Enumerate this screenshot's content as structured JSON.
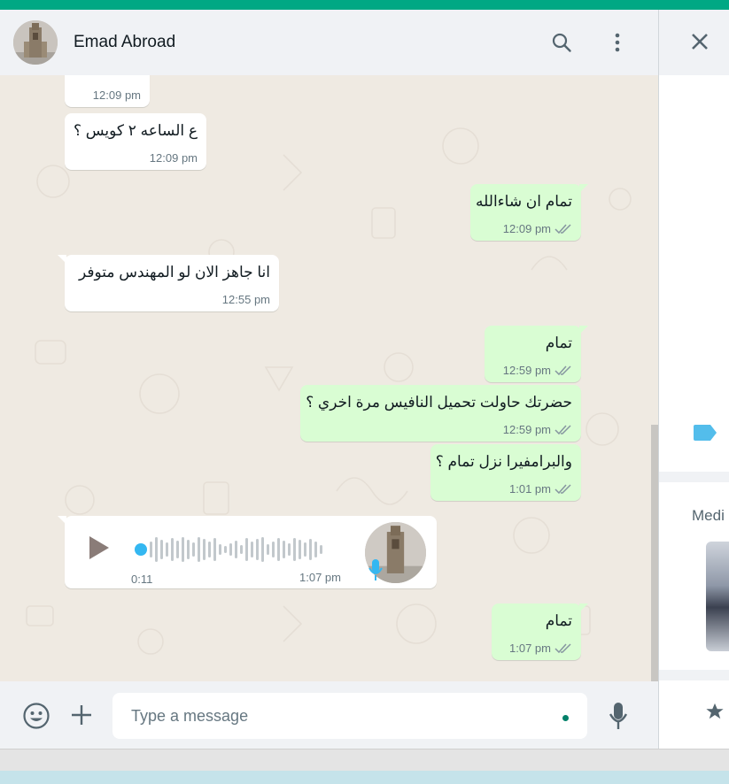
{
  "chat": {
    "contact_name": "Emad Abroad",
    "messages": [
      {
        "dir": "in",
        "text": "",
        "time": "12:09 pm"
      },
      {
        "dir": "in",
        "text": "ع الساعه ٢ كويس ؟",
        "time": "12:09 pm"
      },
      {
        "dir": "out",
        "text": "تمام ان شاءالله",
        "time": "12:09 pm"
      },
      {
        "dir": "in",
        "text": "انا جاهز الان لو المهندس متوفر",
        "time": "12:55 pm"
      },
      {
        "dir": "out",
        "text": "تمام",
        "time": "12:59 pm"
      },
      {
        "dir": "out",
        "text": "حضرتك حاولت تحميل النافيس مرة اخري ؟",
        "time": "12:59 pm"
      },
      {
        "dir": "out",
        "text": "والبرامفيرا نزل تمام ؟",
        "time": "1:01 pm"
      },
      {
        "dir": "in",
        "type": "voice",
        "duration": "0:11",
        "time": "1:07 pm"
      },
      {
        "dir": "out",
        "text": "تمام",
        "time": "1:07 pm"
      }
    ]
  },
  "composer": {
    "placeholder": "Type a message"
  },
  "right_panel": {
    "media_label": "Medi"
  },
  "icons": {
    "search": "search-icon",
    "menu": "menu-icon",
    "close": "close-icon",
    "emoji": "emoji-icon",
    "attach": "plus-icon",
    "mic": "mic-icon",
    "play": "play-icon",
    "star": "star-icon",
    "label": "label-icon"
  },
  "colors": {
    "accent": "#00a884",
    "outgoing_bubble": "#d9fdd3",
    "incoming_bubble": "#ffffff",
    "read_ticks": "#8696a0",
    "voice_dot": "#34b7f1"
  }
}
